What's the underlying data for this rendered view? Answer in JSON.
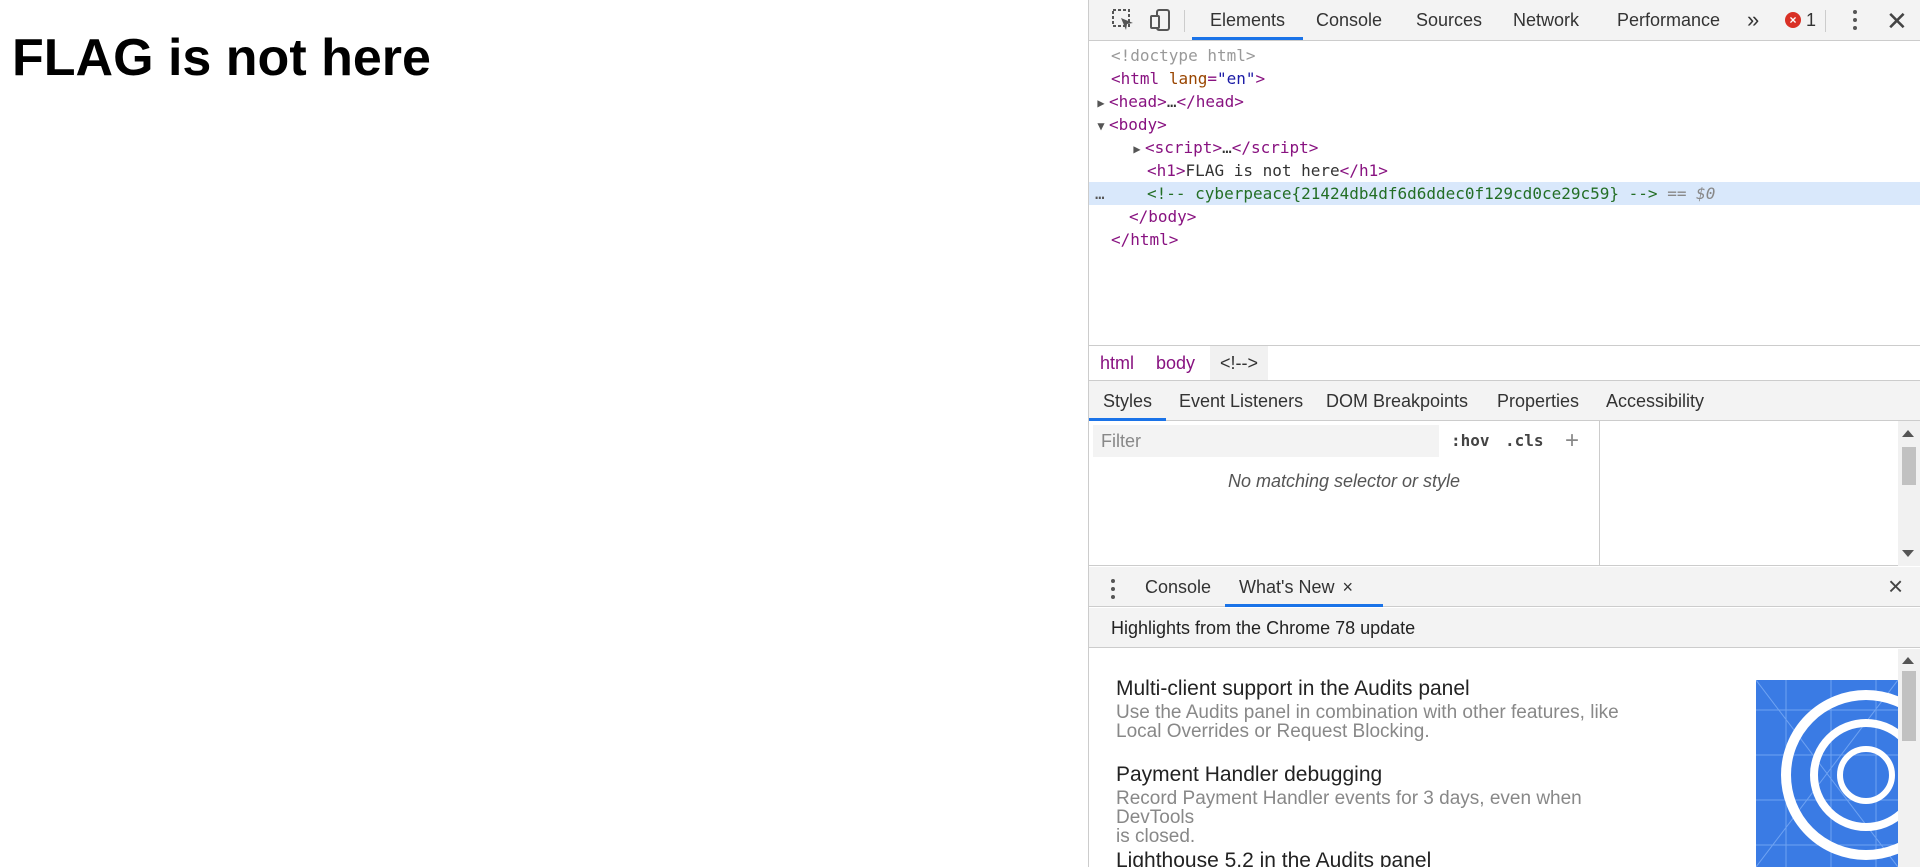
{
  "page": {
    "heading": "FLAG is not here"
  },
  "devtools": {
    "main_tabs": [
      "Elements",
      "Console",
      "Sources",
      "Network",
      "Performance"
    ],
    "more_tabs_glyph": "»",
    "error_count": "1",
    "icons": [
      "inspect-element-icon",
      "device-toolbar-icon",
      "more-tabs-icon",
      "error-icon",
      "kebab-menu-icon",
      "close-icon"
    ],
    "dom": {
      "doctype": "<!doctype html>",
      "html_open_tag": "html",
      "html_attr_name": "lang",
      "html_attr_value": "\"en\"",
      "head_tag": "head",
      "head_ellipsis": "…",
      "body_tag": "body",
      "script_tag": "script",
      "script_ellipsis": "…",
      "h1_tag": "h1",
      "h1_text": "FLAG is not here",
      "comment": "<!-- cyberpeace{21424db4df6d6ddec0f129cd0ce29c59} -->",
      "selected_marker": "== $0",
      "row_ellipsis": "…"
    },
    "breadcrumbs": [
      "html",
      "body",
      "<!-->"
    ],
    "sub_tabs": [
      "Styles",
      "Event Listeners",
      "DOM Breakpoints",
      "Properties",
      "Accessibility"
    ],
    "styles": {
      "filter_placeholder": "Filter",
      "hov_label": ":hov",
      "cls_label": ".cls",
      "add_label": "+",
      "empty_message": "No matching selector or style"
    },
    "drawer": {
      "tabs": [
        "Console",
        "What's New"
      ],
      "tab_close": "×",
      "close": "×",
      "header": "Highlights from the Chrome 78 update",
      "items": [
        {
          "title": "Multi-client support in the Audits panel",
          "desc_line1": "Use the Audits panel in combination with other features, like",
          "desc_line2": "Local Overrides or Request Blocking."
        },
        {
          "title": "Payment Handler debugging",
          "desc_line1": "Record Payment Handler events for 3 days, even when DevTools",
          "desc_line2": "is closed."
        },
        {
          "title": "Lighthouse 5.2 in the Audits panel",
          "desc_line1": "",
          "desc_line2": ""
        }
      ],
      "promo_color": "#3a7be4"
    },
    "colors": {
      "accent": "#1a73e8",
      "tag": "#881280",
      "attr": "#994500",
      "attr_value": "#1a1aa6",
      "comment": "#236e25",
      "error": "#d93025",
      "selected_row": "#d9e8fb"
    }
  }
}
